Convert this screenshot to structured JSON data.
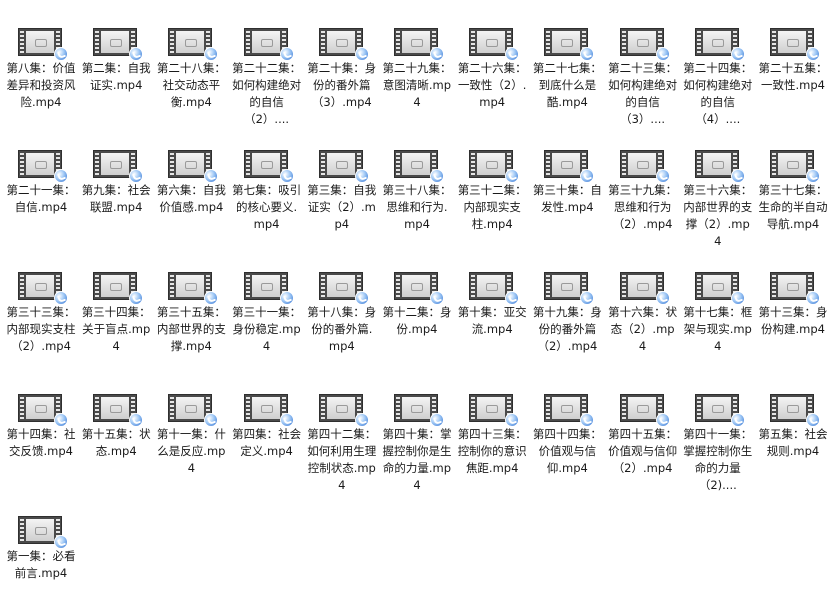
{
  "explorer": {
    "files": [
      {
        "name": "第八集：价值差异和投资风险.mp4",
        "icon": "video-file-icon"
      },
      {
        "name": "第二集：自我证实.mp4",
        "icon": "video-file-icon"
      },
      {
        "name": "第二十八集：社交动态平衡.mp4",
        "icon": "video-file-icon"
      },
      {
        "name": "第二十二集：如何构建绝对的自信（2）....",
        "icon": "video-file-icon"
      },
      {
        "name": "第二十集：身份的番外篇（3）.mp4",
        "icon": "video-file-icon"
      },
      {
        "name": "第二十九集：意图清晰.mp4",
        "icon": "video-file-icon"
      },
      {
        "name": "第二十六集：一致性（2）.mp4",
        "icon": "video-file-icon"
      },
      {
        "name": "第二十七集：到底什么是酷.mp4",
        "icon": "video-file-icon"
      },
      {
        "name": "第二十三集：如何构建绝对的自信（3）....",
        "icon": "video-file-icon"
      },
      {
        "name": "第二十四集：如何构建绝对的自信（4）....",
        "icon": "video-file-icon"
      },
      {
        "name": "第二十五集：一致性.mp4",
        "icon": "video-file-icon"
      },
      {
        "name": "第二十一集：自信.mp4",
        "icon": "video-file-icon"
      },
      {
        "name": "第九集：社会联盟.mp4",
        "icon": "video-file-icon"
      },
      {
        "name": "第六集：自我价值感.mp4",
        "icon": "video-file-icon"
      },
      {
        "name": "第七集：吸引的核心要义.mp4",
        "icon": "video-file-icon"
      },
      {
        "name": "第三集：自我证实（2）.mp4",
        "icon": "video-file-icon"
      },
      {
        "name": "第三十八集：思维和行为.mp4",
        "icon": "video-file-icon"
      },
      {
        "name": "第三十二集：内部现实支柱.mp4",
        "icon": "video-file-icon"
      },
      {
        "name": "第三十集：自发性.mp4",
        "icon": "video-file-icon"
      },
      {
        "name": "第三十九集：思维和行为（2）.mp4",
        "icon": "video-file-icon"
      },
      {
        "name": "第三十六集：内部世界的支撑（2）.mp4",
        "icon": "video-file-icon"
      },
      {
        "name": "第三十七集：生命的半自动导航.mp4",
        "icon": "video-file-icon"
      },
      {
        "name": "第三十三集：内部现实支柱（2）.mp4",
        "icon": "video-file-icon"
      },
      {
        "name": "第三十四集：关于盲点.mp4",
        "icon": "video-file-icon"
      },
      {
        "name": "第三十五集：内部世界的支撑.mp4",
        "icon": "video-file-icon"
      },
      {
        "name": "第三十一集：身份稳定.mp4",
        "icon": "video-file-icon"
      },
      {
        "name": "第十八集：身份的番外篇.mp4",
        "icon": "video-file-icon"
      },
      {
        "name": "第十二集：身份.mp4",
        "icon": "video-file-icon"
      },
      {
        "name": "第十集：亚交流.mp4",
        "icon": "video-file-icon"
      },
      {
        "name": "第十九集：身份的番外篇（2）.mp4",
        "icon": "video-file-icon"
      },
      {
        "name": "第十六集：状态（2）.mp4",
        "icon": "video-file-icon"
      },
      {
        "name": "第十七集：框架与现实.mp4",
        "icon": "video-file-icon"
      },
      {
        "name": "第十三集：身份构建.mp4",
        "icon": "video-file-icon"
      },
      {
        "name": "第十四集：社交反馈.mp4",
        "icon": "video-file-icon"
      },
      {
        "name": "第十五集：状态.mp4",
        "icon": "video-file-icon"
      },
      {
        "name": "第十一集：什么是反应.mp4",
        "icon": "video-file-icon"
      },
      {
        "name": "第四集：社会定义.mp4",
        "icon": "video-file-icon"
      },
      {
        "name": "第四十二集：如何利用生理控制状态.mp4",
        "icon": "video-file-icon"
      },
      {
        "name": "第四十集：掌握控制你是生命的力量.mp4",
        "icon": "video-file-icon"
      },
      {
        "name": "第四十三集：控制你的意识焦距.mp4",
        "icon": "video-file-icon"
      },
      {
        "name": "第四十四集：价值观与信仰.mp4",
        "icon": "video-file-icon"
      },
      {
        "name": "第四十五集：价值观与信仰（2）.mp4",
        "icon": "video-file-icon"
      },
      {
        "name": "第四十一集：掌握控制你生命的力量（2)....",
        "icon": "video-file-icon"
      },
      {
        "name": "第五集：社会规则.mp4",
        "icon": "video-file-icon"
      },
      {
        "name": "第一集：必看前言.mp4",
        "icon": "video-file-icon"
      }
    ]
  }
}
